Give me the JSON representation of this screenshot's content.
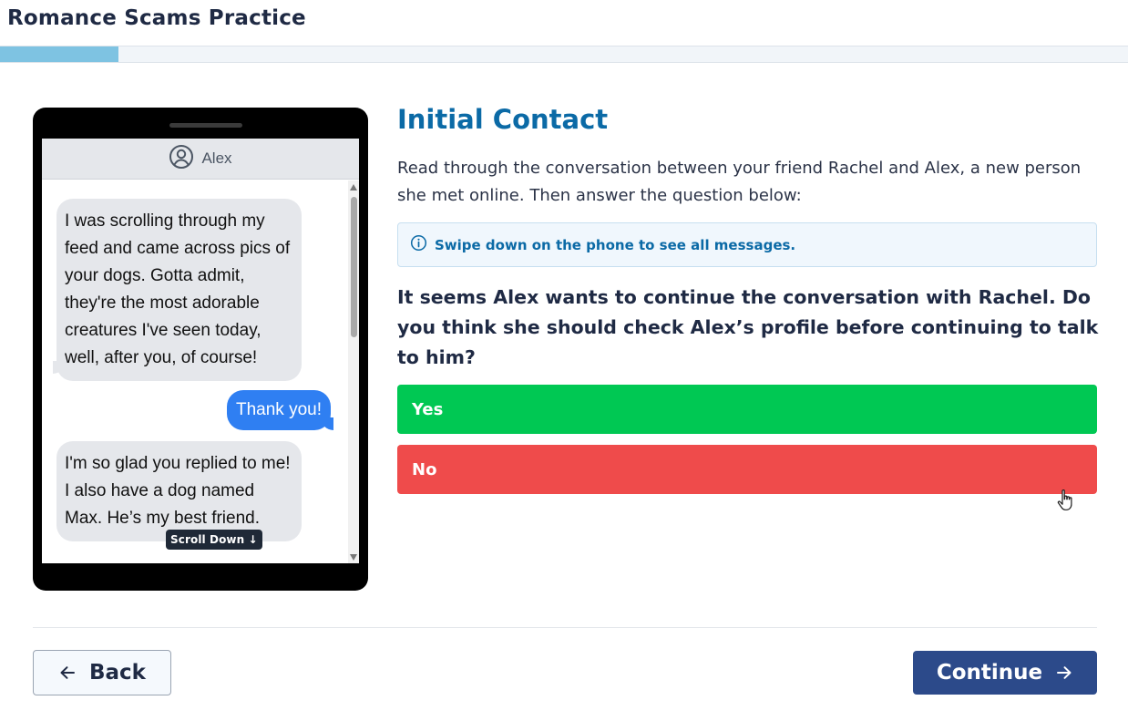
{
  "app": {
    "title": "Romance Scams Practice"
  },
  "progress": {
    "fraction": 0.105
  },
  "phone": {
    "contact_name": "Alex",
    "messages": [
      {
        "from": "Alex",
        "direction": "incoming",
        "text": "I was scrolling through my feed and came across pics of your dogs. Gotta admit, they're the most adorable creatures I've seen today, well, after you, of course!"
      },
      {
        "from": "Rachel",
        "direction": "outgoing",
        "text": "Thank you!"
      },
      {
        "from": "Alex",
        "direction": "incoming",
        "text": "I'm so glad you replied to me! I also have a dog named Max. He’s my best friend."
      }
    ],
    "scroll_hint": "Scroll Down ↓"
  },
  "main": {
    "section_title": "Initial Contact",
    "instructions": "Read through the conversation between your friend Rachel and Alex, a new person she met online. Then answer the question below:",
    "info": "Swipe down on the phone to see all messages.",
    "question": "It seems Alex wants to continue the conversation with Rachel. Do you think she should check Alex’s profile before continuing to talk to him?",
    "answers": {
      "yes": "Yes",
      "no": "No"
    }
  },
  "footer": {
    "back_label": "Back",
    "continue_label": "Continue"
  },
  "colors": {
    "brand_blue": "#0b6aa6",
    "yes_green": "#00c853",
    "no_red": "#ef4b4b",
    "continue_navy": "#2c4a8a",
    "message_out_blue": "#2f7ff2"
  }
}
